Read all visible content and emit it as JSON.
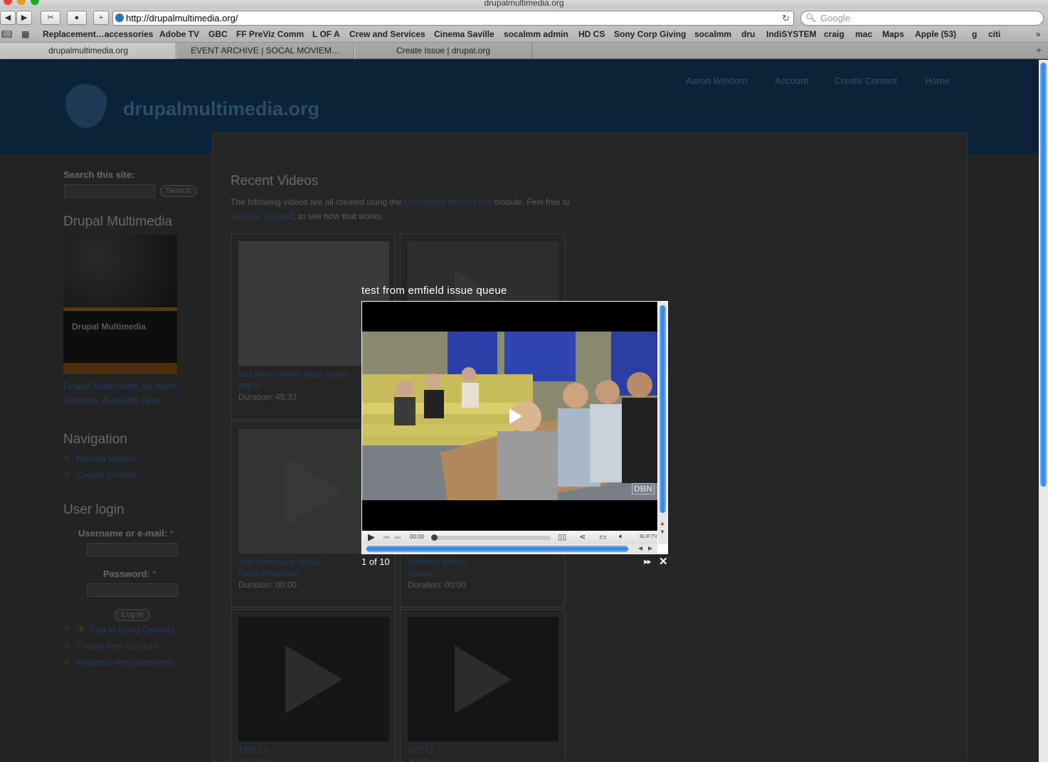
{
  "browser": {
    "window_title": "drupalmultimedia.org",
    "url": "http://drupalmultimedia.org/",
    "search_placeholder": "Google",
    "bookmarks": [
      "Replacement…accessories",
      "Adobe TV",
      "GBC",
      "FF PreViz Comm",
      "L OF A",
      "Crew and Services",
      "Cinema Saville",
      "socalmm admin",
      "HD CS",
      "Sony Corp Giving",
      "socalmm",
      "dru",
      "IndiSYSTEM",
      "craig",
      "mac",
      "Maps",
      "Apple (53)",
      "g",
      "citi"
    ],
    "tabs": [
      {
        "label": "drupalmultimedia.org",
        "active": true
      },
      {
        "label": "EVENT ARCHIVE | SOCAL MOVIEM…",
        "active": false
      },
      {
        "label": "Create Issue | drupal.org",
        "active": false
      }
    ]
  },
  "site": {
    "name": "drupalmultimedia.org",
    "nav": [
      "Aaron Winborn",
      "Account",
      "Create Content",
      "Home"
    ]
  },
  "sidebar": {
    "search_label": "Search this site:",
    "search_button": "Search",
    "book_heading": "Drupal Multimedia",
    "book_cover_title": "Drupal Multimedia",
    "book_link_line1": "Drupal Multimedia, by Aaron",
    "book_link_line2": "Winborn, Available Now!",
    "navigation_heading": "Navigation",
    "navigation_items": [
      "Recent Videos",
      "Create content"
    ],
    "login_heading": "User login",
    "username_label": "Username or e-mail:",
    "password_label": "Password:",
    "required_mark": "*",
    "login_button": "Log in",
    "login_links": [
      "Log in using OpenID",
      "Create new account",
      "Request new password"
    ]
  },
  "main": {
    "title": "Recent Videos",
    "intro_before": "The following videos are all created using the ",
    "intro_link1": "Embedded Media Field",
    "intro_middle": " module. Feel free to ",
    "intro_link2": "add one yourself",
    "intro_after": ", to see how that works.",
    "videos": [
      {
        "title": "test from emfield issue queue",
        "provider": "Blip.tv",
        "duration": "Duration: 45:33"
      },
      {
        "title": "",
        "provider": "",
        "duration": ""
      },
      {
        "title": "Test from issue queue",
        "provider": "Flickr Photosets",
        "duration": "Duration: 00:00"
      },
      {
        "title": "Brothers Bloom",
        "provider": "Vimeo",
        "duration": "Duration: 00:00"
      },
      {
        "title": "132123",
        "provider": "YouTube",
        "duration": ""
      },
      {
        "title": "TEST2",
        "provider": "YouTube",
        "duration": ""
      }
    ]
  },
  "lightbox": {
    "title": "test from emfield issue queue",
    "time": "00:00",
    "brand": "BLIP.TV",
    "watermark": "DBN",
    "counter": "1 of 10",
    "progress_fraction": 0
  }
}
